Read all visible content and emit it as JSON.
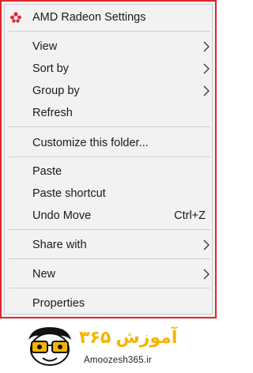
{
  "menu": {
    "items": [
      {
        "label": "AMD Radeon Settings",
        "icon": "amd-radeon-icon"
      },
      {
        "label": "View",
        "submenu": true
      },
      {
        "label": "Sort by",
        "submenu": true
      },
      {
        "label": "Group by",
        "submenu": true
      },
      {
        "label": "Refresh"
      },
      {
        "label": "Customize this folder..."
      },
      {
        "label": "Paste"
      },
      {
        "label": "Paste shortcut"
      },
      {
        "label": "Undo Move",
        "shortcut": "Ctrl+Z"
      },
      {
        "label": "Share with",
        "submenu": true
      },
      {
        "label": "New",
        "submenu": true
      },
      {
        "label": "Properties"
      }
    ]
  },
  "colors": {
    "highlight_border": "#e0262e",
    "menu_background": "#f2f2f2",
    "separator": "#cfcfcf",
    "amd_icon": "#e0262e",
    "watermark_yellow": "#f5b400"
  },
  "watermark": {
    "brand": "آموزش ۳۶۵",
    "site": "Amoozesh365.ir",
    "icon": "cartoon-face-icon"
  }
}
